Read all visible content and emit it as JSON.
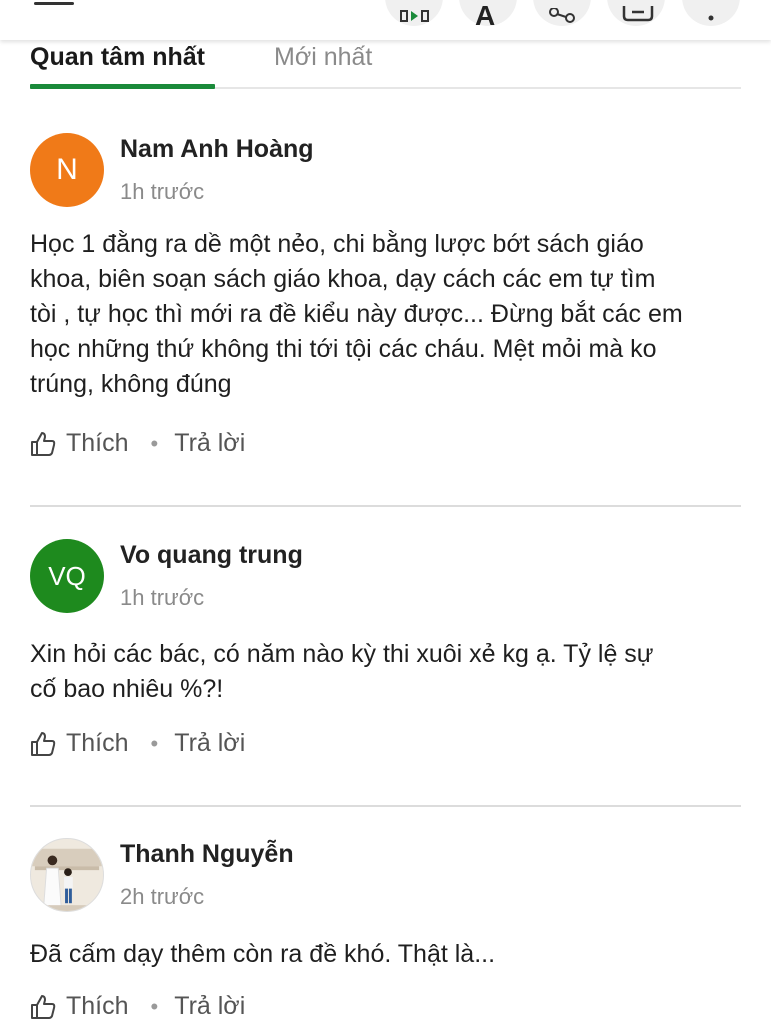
{
  "tabs": [
    {
      "label": "Quan tâm nhất",
      "active": true
    },
    {
      "label": "Mới nhất",
      "active": false
    }
  ],
  "toolbar": {
    "icons": [
      "menu-icon",
      "audio-icon",
      "font-size-icon",
      "share-icon",
      "comment-icon",
      "more-icon"
    ],
    "font_label": "A"
  },
  "accent_color": "#1a8a3a",
  "comments": [
    {
      "avatar_initials": "N",
      "avatar_color": "#f07a18",
      "author": "Nam Anh Hoàng",
      "time": "1h trước",
      "lines": [
        "Học 1 đằng ra dề một nẻo, chi bằng lược bớt sách giáo",
        "khoa, biên soạn sách giáo khoa, dạy cách các em tự tìm",
        "tòi , tự học thì mới ra đề kiểu này được... Đừng bắt các em",
        "học những thứ không thi tới tội các cháu. Mệt mỏi mà ko",
        "trúng, không đúng"
      ],
      "like_label": "Thích",
      "reply_label": "Trả lời"
    },
    {
      "avatar_initials": "VQ",
      "avatar_color": "#1e8a1e",
      "author": "Vo quang trung",
      "time": "1h trước",
      "lines": [
        "Xin hỏi các bác, có năm nào kỳ thi xuôi xẻ kg ạ. Tỷ lệ sự",
        "cố bao nhiêu %?!"
      ],
      "like_label": "Thích",
      "reply_label": "Trả lời"
    },
    {
      "avatar_initials": "",
      "avatar_color": "#e8e4dc",
      "author": "Thanh Nguyễn",
      "time": "2h trước",
      "lines": [
        "Đã cấm dạy thêm còn ra đề khó. Thật là..."
      ],
      "like_label": "Thích",
      "reply_label": "Trả lời"
    }
  ]
}
